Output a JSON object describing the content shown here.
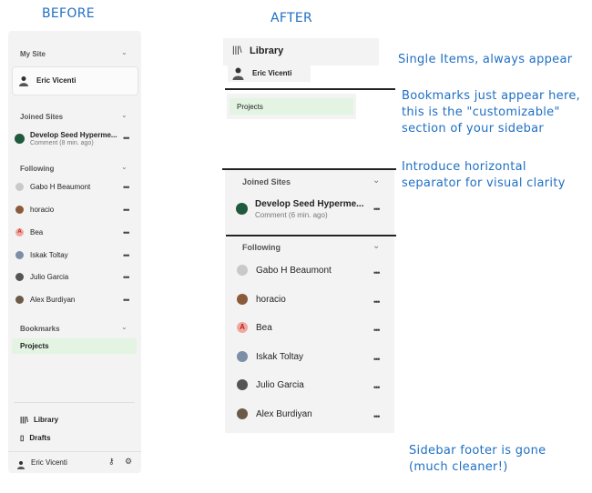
{
  "headings": {
    "before": "BEFORE",
    "after": "AFTER"
  },
  "before": {
    "my_site": {
      "label": "My Site",
      "user": "Eric Vicenti"
    },
    "joined_sites": {
      "label": "Joined Sites",
      "site": {
        "title": "Develop Seed Hyperme...",
        "type": "Comment",
        "time": "(8 min. ago)"
      }
    },
    "following": {
      "label": "Following",
      "people": [
        "Gabo H Beaumont",
        "horacio",
        "Bea",
        "Iskak Toltay",
        "Julio Garcia",
        "Alex Burdiyan"
      ]
    },
    "bookmarks": {
      "label": "Bookmarks",
      "items": [
        "Projects"
      ]
    },
    "nav": {
      "library": "Library",
      "drafts": "Drafts"
    },
    "footer": {
      "user": "Eric Vicenti"
    }
  },
  "after": {
    "library": "Library",
    "user": "Eric Vicenti",
    "bookmark": "Projects",
    "joined_sites": {
      "label": "Joined Sites",
      "site": {
        "title": "Develop Seed Hyperme...",
        "type": "Comment",
        "time": "(6 min. ago)"
      }
    },
    "following": {
      "label": "Following",
      "people": [
        "Gabo H Beaumont",
        "horacio",
        "Bea",
        "Iskak Toltay",
        "Julio Garcia",
        "Alex Burdiyan"
      ]
    }
  },
  "notes": {
    "single_items": "Single Items, always appear",
    "bookmarks_1": "Bookmarks just appear here,",
    "bookmarks_2": "this is the \"customizable\"",
    "bookmarks_3": "section of your sidebar",
    "separator_1": "Introduce horizontal",
    "separator_2": "separator for visual clarity",
    "footer_1": "Sidebar footer is gone",
    "footer_2": "(much cleaner!)"
  },
  "colors": {
    "annotation": "#1f6fc4",
    "sidebar_bg": "#f3f3f3",
    "bookmark_bg": "#e3f4e3"
  },
  "icons": {
    "bea": "letter-a-avatar",
    "site": "site-logo",
    "more": "ellipsis-icon"
  }
}
